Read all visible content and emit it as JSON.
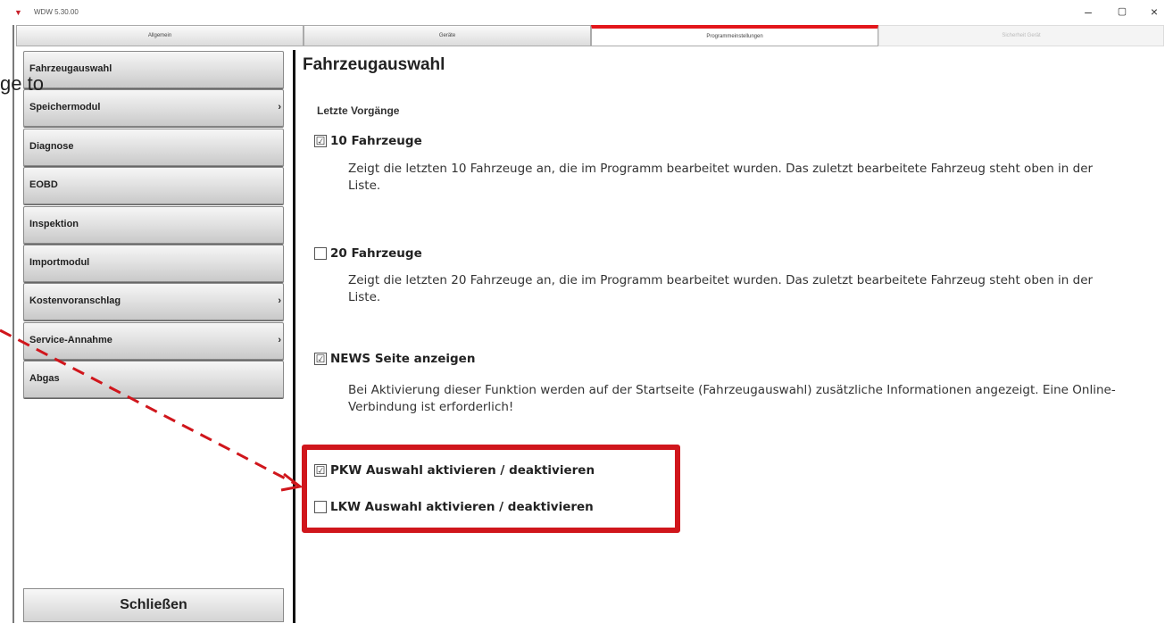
{
  "window": {
    "title": "WDW 5.30.00",
    "min_label": "–",
    "max_label": "▢",
    "close_label": "×"
  },
  "tabs": [
    {
      "label": "Allgemein"
    },
    {
      "label": "Geräte"
    },
    {
      "label": "Programmeinstellungen"
    },
    {
      "label": "Sicherheit Gerät"
    }
  ],
  "sidebar": {
    "items": [
      {
        "label": "Fahrzeugauswahl",
        "arrow": ""
      },
      {
        "label": "Speichermodul",
        "arrow": "›"
      },
      {
        "label": "Diagnose",
        "arrow": ""
      },
      {
        "label": "EOBD",
        "arrow": ""
      },
      {
        "label": "Inspektion",
        "arrow": ""
      },
      {
        "label": "Importmodul",
        "arrow": ""
      },
      {
        "label": "Kostenvoranschlag",
        "arrow": "›"
      },
      {
        "label": "Service-Annahme",
        "arrow": "›"
      },
      {
        "label": "Abgas",
        "arrow": ""
      }
    ],
    "close_label": "Schließen"
  },
  "main": {
    "title": "Fahrzeugauswahl",
    "section_title": "Letzte Vorgänge",
    "options": [
      {
        "label": "10 Fahrzeuge",
        "checked": "☑",
        "description": "Zeigt die letzten 10 Fahrzeuge an, die im Programm bearbeitet wurden. Das zuletzt bearbeitete Fahrzeug steht oben in der Liste."
      },
      {
        "label": "20 Fahrzeuge",
        "checked": "",
        "description": "Zeigt die letzten 20 Fahrzeuge an, die im Programm bearbeitet wurden. Das zuletzt bearbeitete Fahrzeug steht oben in der Liste."
      },
      {
        "label": "NEWS Seite anzeigen",
        "checked": "☑",
        "description": "Bei Aktivierung dieser Funktion werden auf der Startseite (Fahrzeugauswahl) zusätzliche Informationen angezeigt. Eine Online-Verbindung ist erforderlich!"
      },
      {
        "label": "PKW Auswahl aktivieren / deaktivieren",
        "checked": "☑"
      },
      {
        "label": "LKW Auswahl aktivieren / deaktivieren",
        "checked": ""
      }
    ]
  },
  "annotation": {
    "overlay_text": "ge to",
    "box_color": "#d0161c",
    "arrow_color": "#d0161c"
  },
  "colors": {
    "active_tab_accent": "#e3161b"
  }
}
